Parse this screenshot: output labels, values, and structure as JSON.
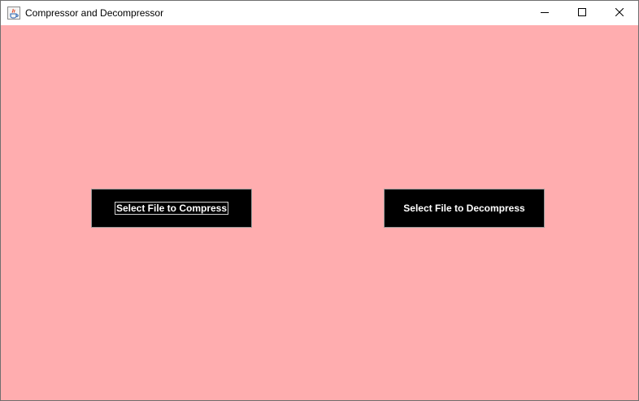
{
  "window": {
    "title": "Compressor and Decompressor",
    "app_icon": "java-cup-icon",
    "controls": {
      "minimize_icon": "minimize-icon",
      "maximize_icon": "maximize-icon",
      "close_icon": "close-icon"
    }
  },
  "main": {
    "background_color": "#ffadaf",
    "compress_button": {
      "label": "Select File to Compress",
      "focused": true
    },
    "decompress_button": {
      "label": "Select File to Decompress",
      "focused": false
    }
  }
}
